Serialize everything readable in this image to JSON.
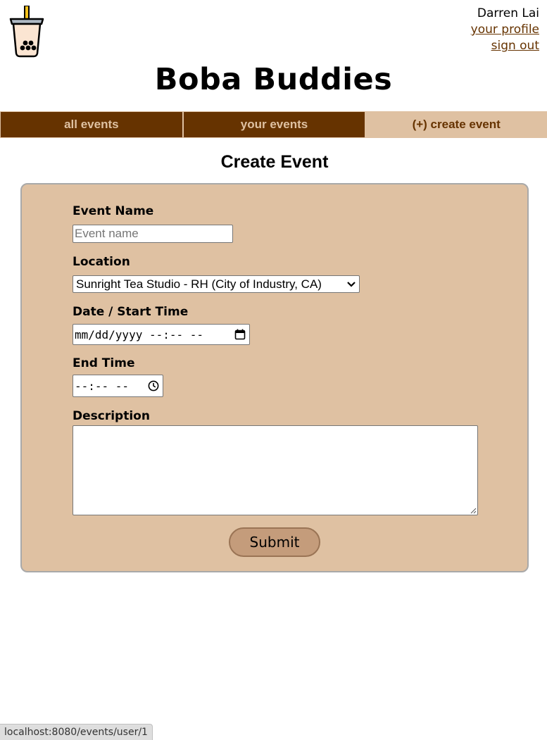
{
  "header": {
    "logo_icon": "boba-tea-cup-icon",
    "user_name": "Darren Lai",
    "profile_link": "your profile",
    "signout_link": "sign out",
    "site_title": "Boba Buddies"
  },
  "nav": {
    "tabs": [
      {
        "label": "all events",
        "active": false
      },
      {
        "label": "your events",
        "active": false
      },
      {
        "label": "(+) create event",
        "active": true
      }
    ]
  },
  "main": {
    "heading": "Create Event",
    "form": {
      "event_name_label": "Event Name",
      "event_name_placeholder": "Event name",
      "event_name_value": "",
      "location_label": "Location",
      "location_selected": "Sunright Tea Studio - RH (City of Industry, CA)",
      "start_label": "Date / Start Time",
      "start_value_placeholder": "mm/dd/yyyy --:-- --",
      "end_label": "End Time",
      "end_value_placeholder": "--:-- --",
      "description_label": "Description",
      "description_value": "",
      "submit_label": "Submit"
    }
  },
  "status_bar": {
    "url": "localhost:8080/events/user/1"
  },
  "colors": {
    "brand_dark": "#663300",
    "brand_light": "#dfc1a2",
    "button": "#c49c7b"
  }
}
